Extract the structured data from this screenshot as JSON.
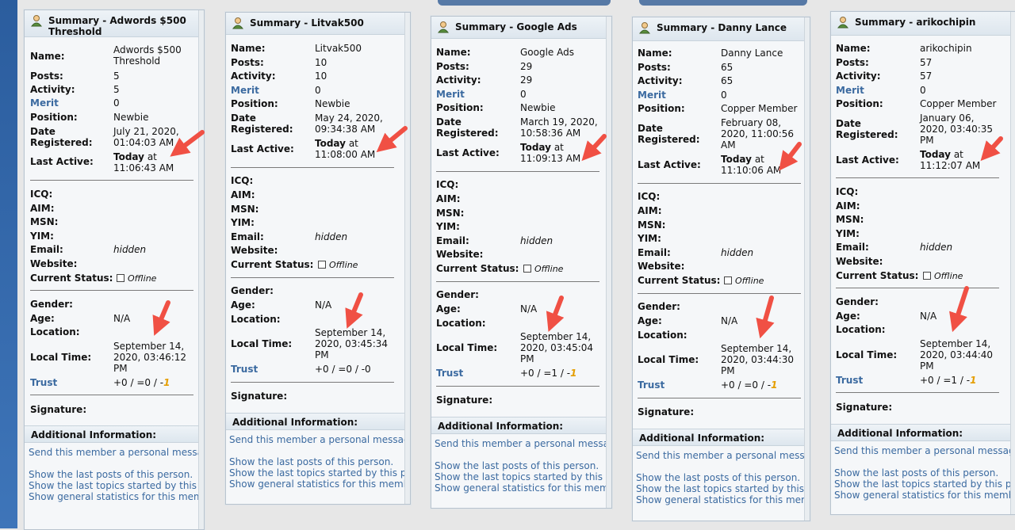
{
  "colors": {
    "accent": "#3b6aa0",
    "arrow": "#f05044",
    "orange": "#e59e00"
  },
  "labels": {
    "name": "Name:",
    "posts": "Posts:",
    "activity": "Activity:",
    "merit": "Merit",
    "position": "Position:",
    "date": "Date",
    "registered": "Registered:",
    "last_active": "Last Active:",
    "icq": "ICQ:",
    "aim": "AIM:",
    "msn": "MSN:",
    "yim": "YIM:",
    "email": "Email:",
    "website": "Website:",
    "current_status": "Current Status:",
    "gender": "Gender:",
    "age": "Age:",
    "location": "Location:",
    "local_time": "Local Time:",
    "trust": "Trust",
    "signature": "Signature:",
    "additional_info": "Additional Information:",
    "send_pm": "Send this member a personal message.",
    "show_posts": "Show the last posts of this person.",
    "show_topics": "Show the last topics started by this person.",
    "show_stats": "Show general statistics for this member."
  },
  "profiles": [
    {
      "title": "Summary - Adwords $500 Threshold",
      "name": "Adwords $500 Threshold",
      "posts": "5",
      "activity": "5",
      "merit": "0",
      "position": "Newbie",
      "registered": "July 21, 2020, 01:04:03 AM",
      "last_active_a": "Today",
      "last_active_b": "at",
      "last_active_c": "11:06:43 AM",
      "email": "hidden",
      "status": "Offline",
      "age": "N/A",
      "local_time": "September 14, 2020, 03:46:12 PM",
      "trust_a": "+0 / =0 / -",
      "trust_b": "1"
    },
    {
      "title": "Summary - Litvak500",
      "name": "Litvak500",
      "posts": "10",
      "activity": "10",
      "merit": "0",
      "position": "Newbie",
      "registered": "May 24, 2020, 09:34:38 AM",
      "last_active_a": "Today",
      "last_active_b": "at",
      "last_active_c": "11:08:00 AM",
      "email": "hidden",
      "status": "Offline",
      "age": "N/A",
      "local_time": "September 14, 2020, 03:45:34 PM",
      "trust_a": "+0 / =0 / -0",
      "trust_b": ""
    },
    {
      "title": "Summary - Google Ads",
      "name": "Google Ads",
      "posts": "29",
      "activity": "29",
      "merit": "0",
      "position": "Newbie",
      "registered": "March 19, 2020, 10:58:36 AM",
      "last_active_a": "Today",
      "last_active_b": "at",
      "last_active_c": "11:09:13 AM",
      "email": "hidden",
      "status": "Offline",
      "age": "N/A",
      "local_time": "September 14, 2020, 03:45:04 PM",
      "trust_a": "+0 / =1 / -",
      "trust_b": "1"
    },
    {
      "title": "Summary - Danny Lance",
      "name": "Danny Lance",
      "posts": "65",
      "activity": "65",
      "merit": "0",
      "position": "Copper Member",
      "registered": "February 08, 2020, 11:00:56 AM",
      "last_active_a": "Today",
      "last_active_b": "at",
      "last_active_c": "11:10:06 AM",
      "email": "hidden",
      "status": "Offline",
      "age": "N/A",
      "local_time": "September 14, 2020, 03:44:30 PM",
      "trust_a": "+0 / =0 / -",
      "trust_b": "1"
    },
    {
      "title": "Summary - arikochipin",
      "name": "arikochipin",
      "posts": "57",
      "activity": "57",
      "merit": "0",
      "position": "Copper Member",
      "registered": "January 06, 2020, 03:40:35 PM",
      "last_active_a": "Today",
      "last_active_b": "at",
      "last_active_c": "11:12:07 AM",
      "email": "hidden",
      "status": "Offline",
      "age": "N/A",
      "local_time": "September 14, 2020, 03:44:40 PM",
      "trust_a": "+0 / =1 / -",
      "trust_b": "1"
    }
  ]
}
